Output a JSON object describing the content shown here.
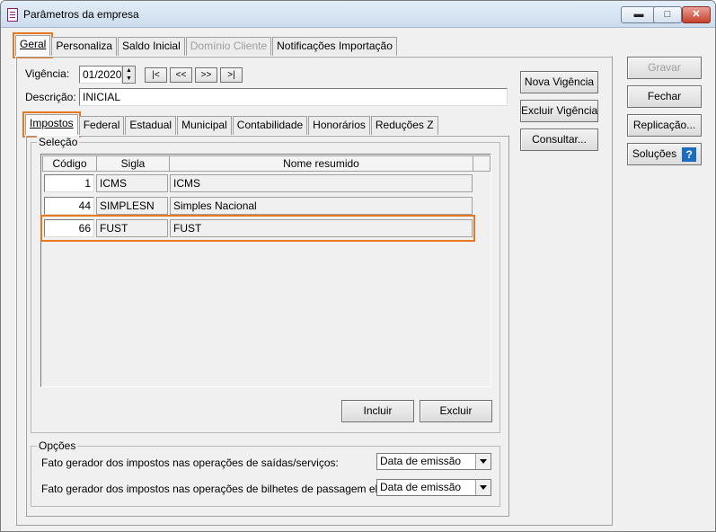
{
  "window": {
    "title": "Parâmetros da empresa"
  },
  "main_tabs": [
    "Geral",
    "Personaliza",
    "Saldo Inicial",
    "Domínio Cliente",
    "Notificações Importação"
  ],
  "vigencia": {
    "label": "Vigência:",
    "value": "01/2020",
    "nav": [
      "|<",
      "<<",
      ">>",
      ">|"
    ]
  },
  "descricao": {
    "label": "Descrição:",
    "value": "INICIAL"
  },
  "sub_tabs": [
    "Impostos",
    "Federal",
    "Estadual",
    "Municipal",
    "Contabilidade",
    "Honorários",
    "Reduções Z"
  ],
  "selecao": {
    "label": "Seleção",
    "columns": [
      "Código",
      "Sigla",
      "Nome resumido"
    ],
    "rows": [
      {
        "codigo": "1",
        "sigla": "ICMS",
        "nome": "ICMS"
      },
      {
        "codigo": "44",
        "sigla": "SIMPLESN",
        "nome": "Simples Nacional"
      },
      {
        "codigo": "66",
        "sigla": "FUST",
        "nome": "FUST"
      }
    ],
    "incluir": "Incluir",
    "excluir": "Excluir"
  },
  "opcoes": {
    "label": "Opções",
    "fato_saidas": {
      "label": "Fato gerador dos impostos nas operações de saídas/serviços:",
      "value": "Data de emissão"
    },
    "fato_bilhetes": {
      "label": "Fato gerador dos impostos nas operações de bilhetes de passagem eletrônico:",
      "value": "Data de emissão"
    }
  },
  "vigencia_buttons": {
    "nova": "Nova Vigência",
    "excluir": "Excluir Vigência",
    "consultar": "Consultar..."
  },
  "side_buttons": {
    "gravar": "Gravar",
    "fechar": "Fechar",
    "replicacao": "Replicação...",
    "solucoes": "Soluções",
    "help": "?"
  },
  "colors": {
    "highlight": "#e87722",
    "help_icon": "#1e6cbe"
  }
}
